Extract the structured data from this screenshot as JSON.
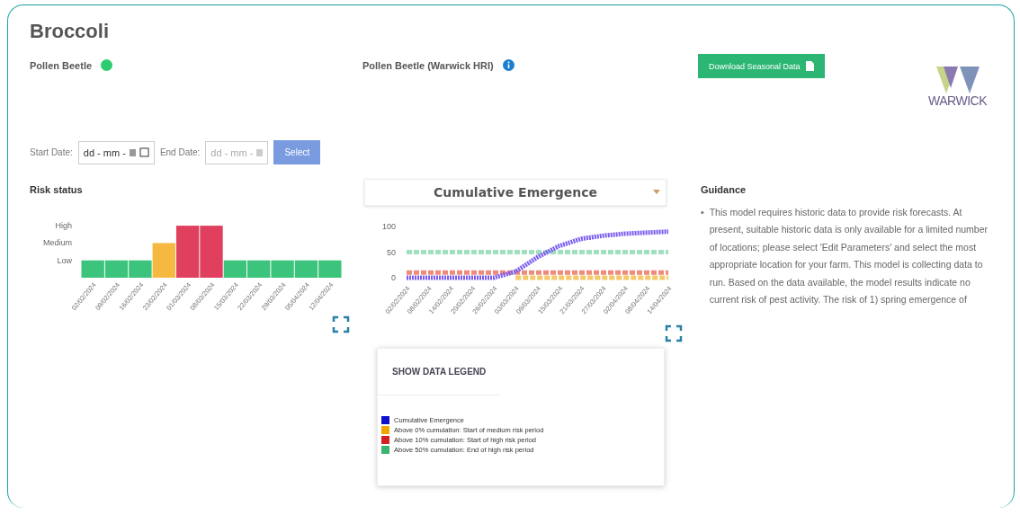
{
  "title": "Broccoli",
  "models": [
    {
      "kind": "status",
      "name": "Pollen Beetle",
      "color": "#2ecc71"
    },
    {
      "kind": "info",
      "name": "Pollen Beetle (Warwick HRI)"
    }
  ],
  "download_button": "Download Seasonal Data",
  "logo": {
    "text": "WARWICK"
  },
  "date_filter": {
    "start_label": "Start Date:",
    "start_placeholder": "dd - mm -",
    "end_label": "End Date:",
    "end_placeholder": "dd - mm -",
    "button": "Select"
  },
  "risk_panel": {
    "title": "Risk status",
    "axis_labels": [
      "High",
      "Medium",
      "Low"
    ],
    "bars": [
      {
        "date": "02/02/2024",
        "kind": "low",
        "color": "#3cc47c"
      },
      {
        "date": "09/02/2024",
        "kind": "low",
        "color": "#3cc47c"
      },
      {
        "date": "16/02/2024",
        "kind": "low",
        "color": "#3cc47c"
      },
      {
        "date": "23/02/2024",
        "kind": "medium",
        "color": "#f5b942"
      },
      {
        "date": "01/03/2024",
        "kind": "high",
        "color": "#e0405e"
      },
      {
        "date": "08/03/2024",
        "kind": "high",
        "color": "#e0405e"
      },
      {
        "date": "15/03/2024",
        "kind": "low",
        "color": "#3cc47c"
      },
      {
        "date": "22/03/2024",
        "kind": "low",
        "color": "#3cc47c"
      },
      {
        "date": "29/03/2024",
        "kind": "low",
        "color": "#3cc47c"
      },
      {
        "date": "05/04/2024",
        "kind": "low",
        "color": "#3cc47c"
      },
      {
        "date": "12/04/2024",
        "kind": "low",
        "color": "#3cc47c"
      }
    ]
  },
  "emergence_panel": {
    "selector": "Cumulative Emergence",
    "chart_data": {
      "type": "line",
      "x": [
        "02/02/2024",
        "08/02/2024",
        "14/02/2024",
        "20/02/2024",
        "26/02/2024",
        "03/03/2024",
        "09/03/2024",
        "15/03/2024",
        "21/03/2024",
        "27/03/2024",
        "02/04/2024",
        "08/04/2024",
        "14/04/2024"
      ],
      "ylim": [
        0,
        100
      ],
      "yticks": [
        0,
        50,
        100
      ],
      "series": [
        {
          "color": "#7b5cf0",
          "line_style": "dotted",
          "values": [
            0,
            0,
            0,
            0,
            0,
            12,
            40,
            62,
            76,
            82,
            86,
            88,
            90
          ]
        },
        {
          "color": "#f5c86a",
          "line_style": "dashed",
          "values": [
            null,
            null,
            null,
            null,
            null,
            0,
            0,
            0,
            0,
            0,
            0,
            0,
            0
          ]
        },
        {
          "color": "#f08a7a",
          "line_style": "dashed",
          "values": [
            10,
            10,
            10,
            10,
            10,
            10,
            10,
            10,
            10,
            10,
            10,
            10,
            10
          ]
        },
        {
          "color": "#9fe0bf",
          "line_style": "dashed",
          "values": [
            50,
            50,
            50,
            50,
            50,
            50,
            50,
            50,
            50,
            50,
            50,
            50,
            50
          ]
        }
      ]
    },
    "legend": {
      "title": "SHOW DATA LEGEND",
      "items": [
        {
          "label": "Cumulative Emergence",
          "color": "#1010cc"
        },
        {
          "label": "Above 0% cumulation: Start of medium risk period",
          "color": "#f0a500"
        },
        {
          "label": "Above 10% cumulation: Start of high risk period",
          "color": "#d42020"
        },
        {
          "label": "Above 50% cumulation: End of high risk period",
          "color": "#3cb371"
        }
      ]
    }
  },
  "guidance": {
    "title": "Guidance",
    "bullet": "•",
    "items": [
      "This model requires historic data to provide risk forecasts. At present, suitable historic data is only available for a limited number of locations; please select 'Edit Parameters' and select the most appropriate location for your farm. This model is collecting data to run. Based on the data available, the model results indicate no current risk of pest activity. The risk of 1) spring emergence of"
    ]
  }
}
